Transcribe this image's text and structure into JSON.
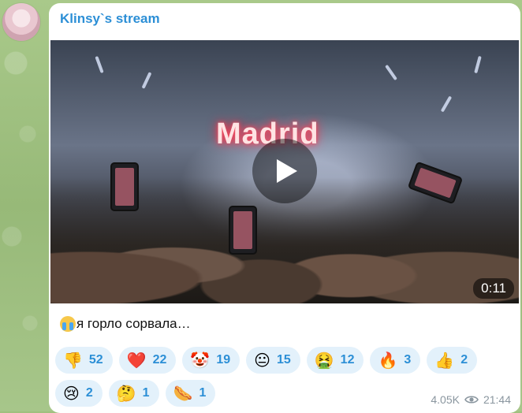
{
  "channel": {
    "name": "Klinsy`s stream"
  },
  "video": {
    "duration": "0:11"
  },
  "message": {
    "caption_emoji": "sob-emoji",
    "caption_text": "я горло сорвала…"
  },
  "reactions": [
    {
      "emoji": "👎",
      "icon": "thumbs-down-emoji",
      "count": "52"
    },
    {
      "emoji": "❤️",
      "icon": "red-heart-emoji",
      "count": "22"
    },
    {
      "emoji": "🤡",
      "icon": "clown-face-emoji",
      "count": "19"
    },
    {
      "emoji": "😐",
      "icon": "neutral-face-emoji",
      "count": "15"
    },
    {
      "emoji": "🤮",
      "icon": "vomiting-face-emoji",
      "count": "12"
    },
    {
      "emoji": "🔥",
      "icon": "fire-emoji",
      "count": "3"
    },
    {
      "emoji": "👍",
      "icon": "thumbs-up-emoji",
      "count": "2"
    },
    {
      "emoji": "😢",
      "icon": "crying-face-emoji",
      "count": "2"
    },
    {
      "emoji": "🤔",
      "icon": "thinking-face-emoji",
      "count": "1"
    },
    {
      "emoji": "🌭",
      "icon": "hot-dog-emoji",
      "count": "1"
    }
  ],
  "footer": {
    "views": "4.05K",
    "views_icon": "eye-icon",
    "time": "21:44"
  },
  "colors": {
    "accent": "#2c8fd6",
    "reaction_bg": "#e3f1fb",
    "meta_text": "#8a969f"
  }
}
